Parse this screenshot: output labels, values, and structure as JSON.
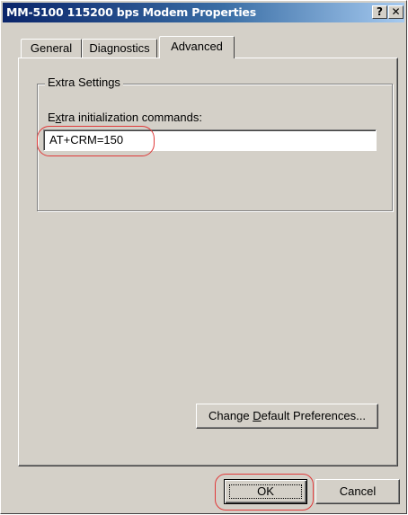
{
  "window": {
    "title": "MM-5100 115200 bps Modem Properties",
    "help_button": "?",
    "close_button": "✕"
  },
  "tabs": [
    {
      "label": "General",
      "active": false
    },
    {
      "label": "Diagnostics",
      "active": false
    },
    {
      "label": "Advanced",
      "active": true
    }
  ],
  "extra_settings": {
    "group_label": "Extra Settings",
    "field_label_pre": "E",
    "field_label_accel": "x",
    "field_label_post": "tra initialization commands:",
    "field_value": "AT+CRM=150"
  },
  "buttons": {
    "change_defaults_pre": "Change ",
    "change_defaults_accel": "D",
    "change_defaults_post": "efault Preferences...",
    "ok": "OK",
    "cancel": "Cancel"
  },
  "colors": {
    "dialog_face": "#d4d0c8",
    "title_gradient_start": "#0a246a",
    "title_gradient_end": "#a6caf0",
    "annotation_red": "#e03a3a"
  }
}
